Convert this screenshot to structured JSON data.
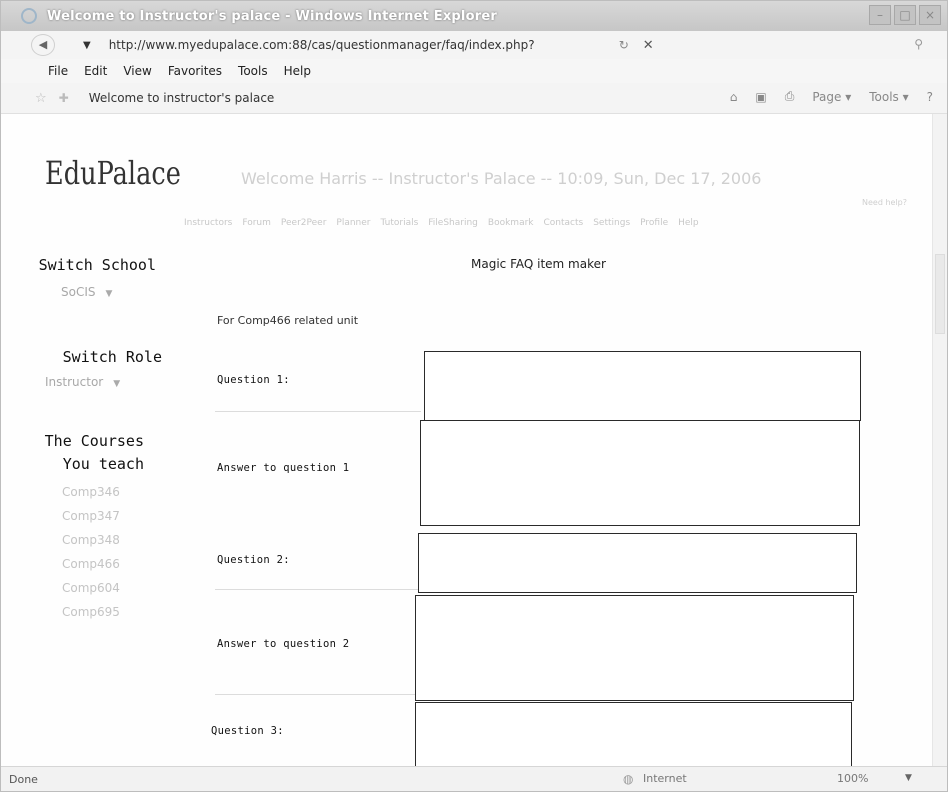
{
  "window": {
    "title": "Welcome to Instructor's palace - Windows Internet Explorer"
  },
  "address": {
    "url": "http://www.myedupalace.com:88/cas/questionmanager/faq/index.php?"
  },
  "menu": [
    "File",
    "Edit",
    "View",
    "Favorites",
    "Tools",
    "Help"
  ],
  "tab": {
    "title": "Welcome to instructor's palace"
  },
  "commands": {
    "page": "Page ▾",
    "tools": "Tools ▾"
  },
  "header": {
    "brand": "EduPalace",
    "welcome": "Welcome Harris  --  Instructor's Palace  --  10:09, Sun, Dec 17, 2006",
    "support": "Need help?",
    "nav": [
      "Instructors",
      "Forum",
      "Peer2Peer",
      "Planner",
      "Tutorials",
      "FileSharing",
      "Bookmark",
      "Contacts",
      "Settings",
      "Profile",
      "Help"
    ]
  },
  "sidebar": {
    "switch_school": "Switch School",
    "school_value": "SoCIS",
    "switch_role": "Switch Role",
    "role_value": "Instructor",
    "courses_heading": "The Courses You teach",
    "courses": [
      "Comp346",
      "Comp347",
      "Comp348",
      "Comp466",
      "Comp604",
      "Comp695"
    ]
  },
  "form": {
    "title": "Magic FAQ item maker",
    "for_unit": "For Comp466   related unit",
    "fields": [
      {
        "label": "Question 1:"
      },
      {
        "label": "Answer to question 1"
      },
      {
        "label": "Question 2:"
      },
      {
        "label": "Answer to question 2"
      },
      {
        "label": "Question 3:"
      }
    ]
  },
  "status": {
    "text": "Done",
    "zone": "Internet",
    "zoom": "100%"
  },
  "colors": {
    "field_border": "#2a2a2a",
    "muted_text": "#c4c4c4"
  }
}
